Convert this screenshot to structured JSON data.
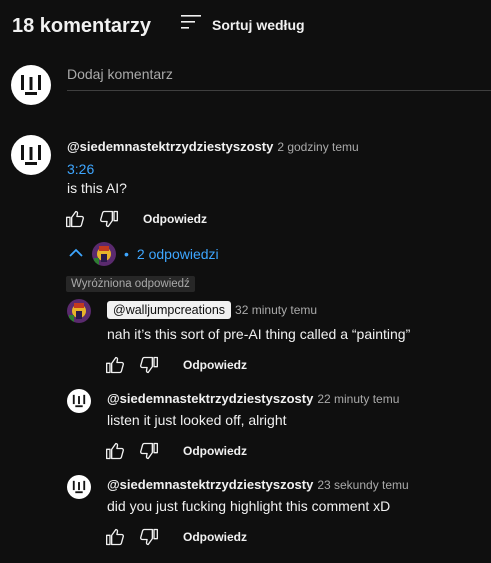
{
  "header": {
    "comment_count": "18 komentarzy",
    "sort_label": "Sortuj według"
  },
  "add_comment": {
    "placeholder": "Dodaj komentarz"
  },
  "comment": {
    "author": "@siedemnastektrzydziestyszosty",
    "time": "2 godziny temu",
    "timestamp_link": "3:26",
    "text": "is this AI?",
    "reply_label": "Odpowiedz"
  },
  "replies_toggle": {
    "label": "2 odpowiedzi",
    "bullet": "•"
  },
  "highlight_badge": "Wyróżniona odpowiedź",
  "replies": [
    {
      "author": "@walljumpcreations",
      "time": "32 minuty temu",
      "text": "nah it’s this sort of pre-AI thing called a “painting”",
      "reply_label": "Odpowiedz"
    },
    {
      "author": "@siedemnastektrzydziestyszosty",
      "time": "22 minuty temu",
      "text": "listen it just looked off, alright",
      "reply_label": "Odpowiedz"
    },
    {
      "author": "@siedemnastektrzydziestyszosty",
      "time": "23 sekundy temu",
      "text": "did you just fucking highlight this comment xD",
      "reply_label": "Odpowiedz"
    }
  ],
  "icons": {
    "sort": "sort-icon",
    "like": "thumbs-up-icon",
    "dislike": "thumbs-down-icon",
    "collapse": "chevron-up-icon"
  },
  "colors": {
    "background": "#0f0f0f",
    "link": "#3ea6ff",
    "muted": "#aaaaaa",
    "text": "#f1f1f1"
  }
}
